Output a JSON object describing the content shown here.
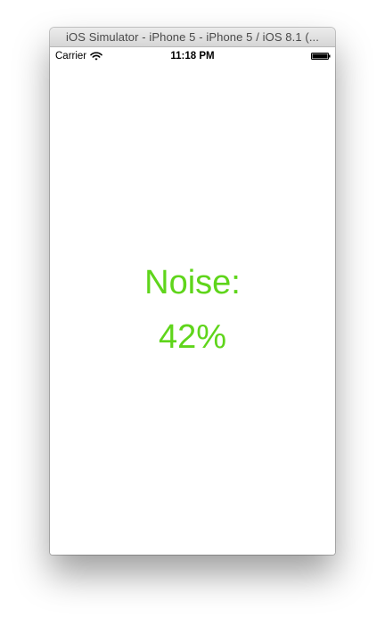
{
  "window": {
    "title": "iOS Simulator - iPhone 5 - iPhone 5 / iOS 8.1 (..."
  },
  "statusbar": {
    "carrier": "Carrier",
    "time": "11:18 PM",
    "wifi_icon": "wifi-icon",
    "battery_icon": "battery-full-icon"
  },
  "content": {
    "label": "Noise:",
    "value": "42%",
    "accent_color": "#5fd51b"
  }
}
